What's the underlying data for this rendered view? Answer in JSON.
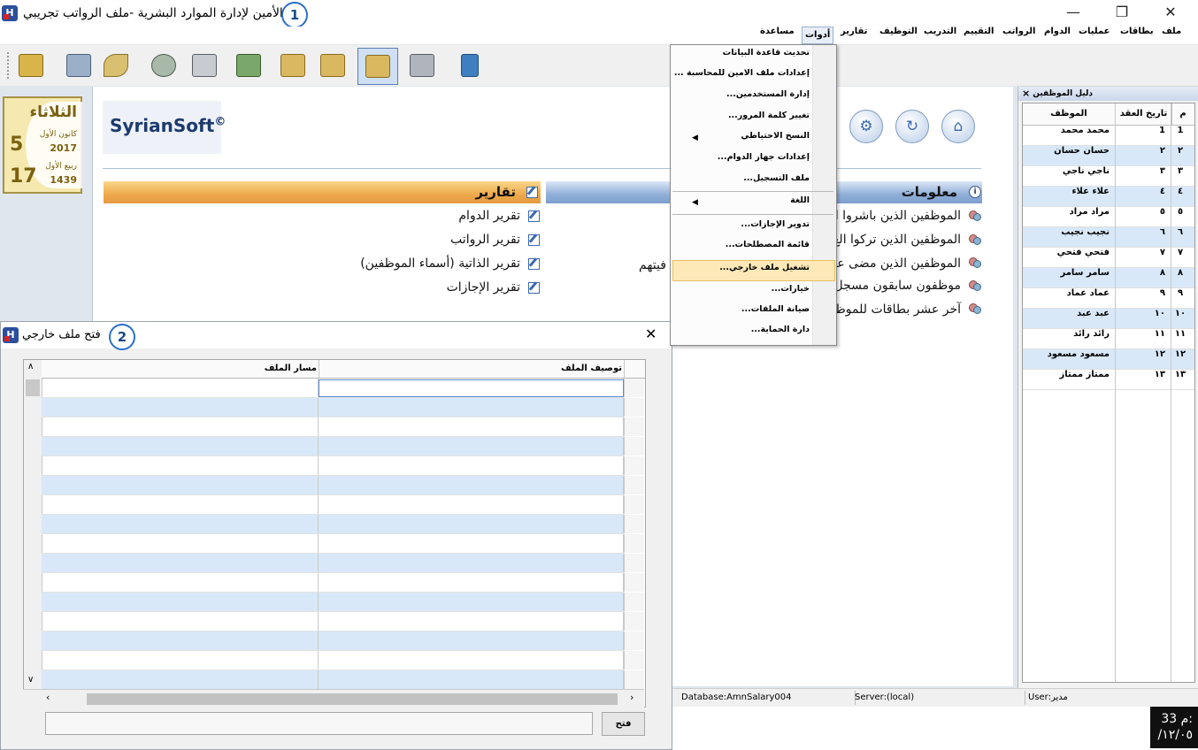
{
  "window": {
    "title": "الأمين لإدارة الموارد البشرية -ملف الرواتب تجريبي",
    "badge": "1",
    "icon_letter": "H",
    "minimize": "—",
    "maximize": "❐",
    "close": "✕"
  },
  "menu": [
    "ملف",
    "بطاقات",
    "عمليات",
    "الدوام",
    "الرواتب",
    "التقييم",
    "التدريب",
    "التوظيف",
    "تقارير",
    "أدوات",
    "مساعدة"
  ],
  "tools_menu": {
    "items": [
      "تحديث قاعدة البيانات",
      "إعدادات ملف الامين للمحاسبة ...",
      "إدارة المستخدمين...",
      "تغيير كلمة المرور...",
      "النسخ الاحتياطي",
      "إعدادات جهاز الدوام...",
      "ملف التسجيل...",
      "اللغة",
      "تدوير الإجازات...",
      "قائمة المصطلحات...",
      "تشغيل ملف خارجي...",
      "خيارات...",
      "صيانة الملفات...",
      "دارة الحماية..."
    ],
    "highlighted": "تشغيل ملف خارجي..."
  },
  "calendar": {
    "weekday": "الثلاثاء",
    "gregorian_day": "5",
    "gregorian_month": "كانون الأول",
    "gregorian_year": "2017",
    "hijri_day": "17",
    "hijri_month": "ربيع الأول",
    "hijri_year": "1439"
  },
  "logo": {
    "text": "SyrianSoft",
    "mark": "©"
  },
  "reports": {
    "title": "تقارير",
    "links": [
      "تقرير الدوام",
      "تقرير الرواتب",
      "تقرير الذاتية (أسماء الموظفين)",
      "تقرير الإجازات"
    ]
  },
  "info": {
    "title": "معلومات",
    "links": [
      "الموظفين الذين باشروا ال",
      "الموظفين الذين تركوا الع",
      "الموظفين الذين مضى عل",
      "موظفون سابقون مسجل",
      "آخر عشر بطاقات للموظف"
    ],
    "fragment": "فيتهم"
  },
  "dialog": {
    "title": "فتح ملف خارجي",
    "badge": "2",
    "close": "✕",
    "col_description": "توصيف الملف",
    "col_path": "مسار الملف",
    "open_button": "فتح",
    "path_value": ""
  },
  "guide": {
    "title": "دليل الموظفين",
    "close": "×",
    "headers": {
      "num": "م",
      "contract_date": "تاريخ العقد",
      "employee": "الموظف"
    },
    "rows": [
      {
        "num": "1",
        "date": "1",
        "name": "محمد محمد"
      },
      {
        "num": "٢",
        "date": "٢",
        "name": "حسان حسان"
      },
      {
        "num": "٣",
        "date": "٣",
        "name": "ناجي ناجي"
      },
      {
        "num": "٤",
        "date": "٤",
        "name": "علاء علاء"
      },
      {
        "num": "٥",
        "date": "٥",
        "name": "مراد مراد"
      },
      {
        "num": "٦",
        "date": "٦",
        "name": "نجيب نجيب"
      },
      {
        "num": "٧",
        "date": "٧",
        "name": "فتحي فتحي"
      },
      {
        "num": "٨",
        "date": "٨",
        "name": "سامر سامر"
      },
      {
        "num": "٩",
        "date": "٩",
        "name": "عماد عماد"
      },
      {
        "num": "١٠",
        "date": "١٠",
        "name": "عبد عبد"
      },
      {
        "num": "١١",
        "date": "١١",
        "name": "رائد رائد"
      },
      {
        "num": "١٢",
        "date": "١٢",
        "name": "مسعود مسعود"
      },
      {
        "num": "١٣",
        "date": "١٣",
        "name": "ممتاز ممتاز"
      }
    ]
  },
  "status": {
    "database": "Database:AmnSalary004",
    "server": "Server:(local)",
    "user": "User:مدير"
  },
  "clock": {
    "time": "م 33:",
    "date": "/١٢/٠٥"
  },
  "colors": {
    "accent": "#2a6fc9",
    "highlight": "#fde9b8",
    "row_alt": "#d8e8f8"
  }
}
